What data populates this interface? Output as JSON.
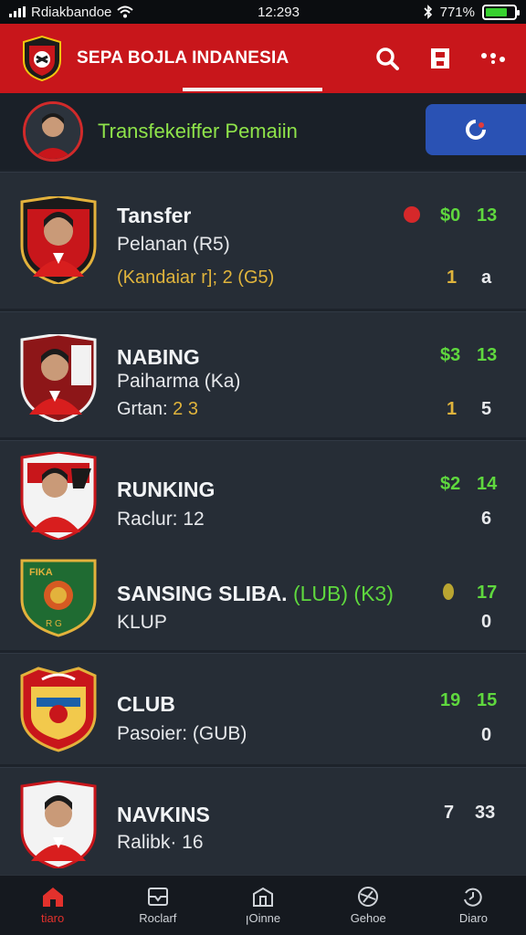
{
  "status_bar": {
    "carrier": "Rdiakbandoe",
    "time": "12:293",
    "battery": "771%",
    "battery_level": 0.77
  },
  "header": {
    "title": "SEPA BOJLA INDANESIA",
    "icons": [
      "search-icon",
      "save-icon",
      "more-icon"
    ]
  },
  "banner": {
    "title": "Transfekeiffer Pemaiin",
    "button_icon": "refresh-icon"
  },
  "cards": [
    {
      "name": "Tansfer",
      "line2": "Pelanan (R5)",
      "line3": "(Kandaiar r]; 2 (G5)",
      "right_top": [
        "$0",
        "13"
      ],
      "right_bottom": [
        "1",
        "a"
      ]
    },
    {
      "name": "NABING",
      "line2": "Paiharma (Ka)",
      "line3_label": "Grtan:",
      "line3_value": "2 3",
      "right_top": [
        "$3",
        "13"
      ],
      "right_bottom": [
        "1",
        "5"
      ]
    },
    {
      "name": "RUNKING",
      "line2": "Raclur: 12",
      "right_top": [
        "$2",
        "14"
      ],
      "right_bottom": [
        "6"
      ]
    },
    {
      "name": "SANSING SLIBA.",
      "name_suffix": "(LUB) (K3)",
      "line2": "KLUP",
      "crest_text": "FIKA",
      "crest_sub": "R G",
      "right_top": [
        "17"
      ],
      "right_bottom": [
        "0"
      ]
    },
    {
      "name": "CLUB",
      "line2": "Pasoier: (GUB)",
      "right_top": [
        "19",
        "15"
      ],
      "right_bottom": [
        "0"
      ]
    },
    {
      "name": "NAVKINS",
      "line2": "Ralibk· 16",
      "right_top": [
        "7",
        "33"
      ]
    }
  ],
  "nav": [
    {
      "label": "tiaro",
      "icon": "home-icon"
    },
    {
      "label": "Roclarf",
      "icon": "inbox-icon"
    },
    {
      "label": "ꞁOinne",
      "icon": "store-icon"
    },
    {
      "label": "Gehoe",
      "icon": "globe-icon"
    },
    {
      "label": "Diaro",
      "icon": "history-icon"
    }
  ],
  "colors": {
    "brand_red": "#c8161b",
    "accent_green": "#5fd83e",
    "accent_blue": "#2a52b4",
    "card_bg": "#262d36"
  }
}
